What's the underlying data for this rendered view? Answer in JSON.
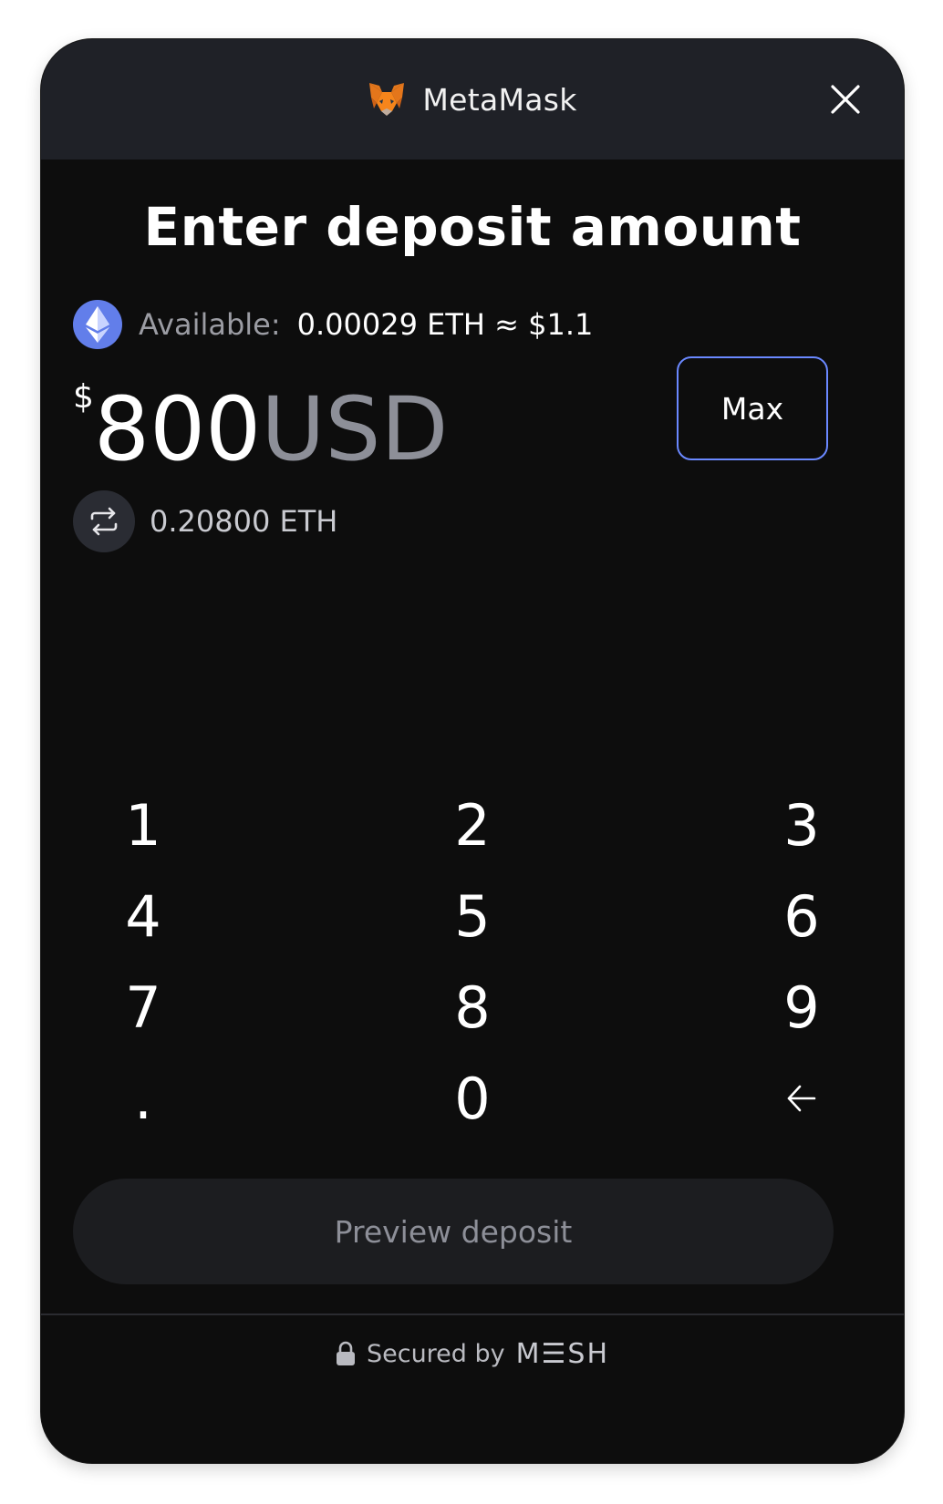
{
  "header": {
    "brand_name": "MetaMask",
    "brand_icon": "metamask-fox-icon",
    "close_icon": "close-icon"
  },
  "title": "Enter deposit amount",
  "available": {
    "label": "Available:",
    "value": "0.00029 ETH ≈ $1.1",
    "token_icon": "ethereum-icon"
  },
  "amount": {
    "currency_symbol": "$",
    "value": "800",
    "unit": "USD"
  },
  "max_button": "Max",
  "conversion": {
    "icon": "swap-arrows-icon",
    "value": "0.20800 ETH"
  },
  "keypad": {
    "keys": [
      "1",
      "2",
      "3",
      "4",
      "5",
      "6",
      "7",
      "8",
      "9",
      ".",
      "0",
      "←"
    ]
  },
  "preview_button": "Preview deposit",
  "footer": {
    "label": "Secured by",
    "brand": "M☰SH",
    "icon": "lock-icon"
  },
  "colors": {
    "card_bg": "#0d0d0d",
    "header_bg": "#1f2127",
    "accent": "#6a88ff",
    "eth": "#627eea",
    "muted_text": "#8d8f98"
  }
}
